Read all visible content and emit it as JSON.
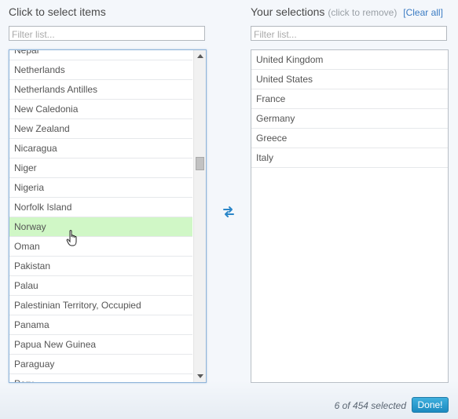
{
  "left": {
    "title": "Click to select items",
    "filter_placeholder": "Filter list...",
    "items": [
      "Nepal",
      "Netherlands",
      "Netherlands Antilles",
      "New Caledonia",
      "New Zealand",
      "Nicaragua",
      "Niger",
      "Nigeria",
      "Norfolk Island",
      "Norway",
      "Oman",
      "Pakistan",
      "Palau",
      "Palestinian Territory, Occupied",
      "Panama",
      "Papua New Guinea",
      "Paraguay",
      "Peru"
    ],
    "hover_item": "Norway",
    "hover_color": "#d0f7c6"
  },
  "right": {
    "title": "Your selections",
    "hint": "(click to remove)",
    "clear_all": "[Clear all]",
    "filter_placeholder": "Filter list...",
    "items": [
      "United Kingdom",
      "United States",
      "France",
      "Germany",
      "Greece",
      "Italy"
    ]
  },
  "swap_icon": "swap-arrows-icon",
  "status": "6 of 454 selected",
  "done_label": "Done!",
  "colors": {
    "accent": "#1c8ac0",
    "link": "#3b7cc3"
  }
}
